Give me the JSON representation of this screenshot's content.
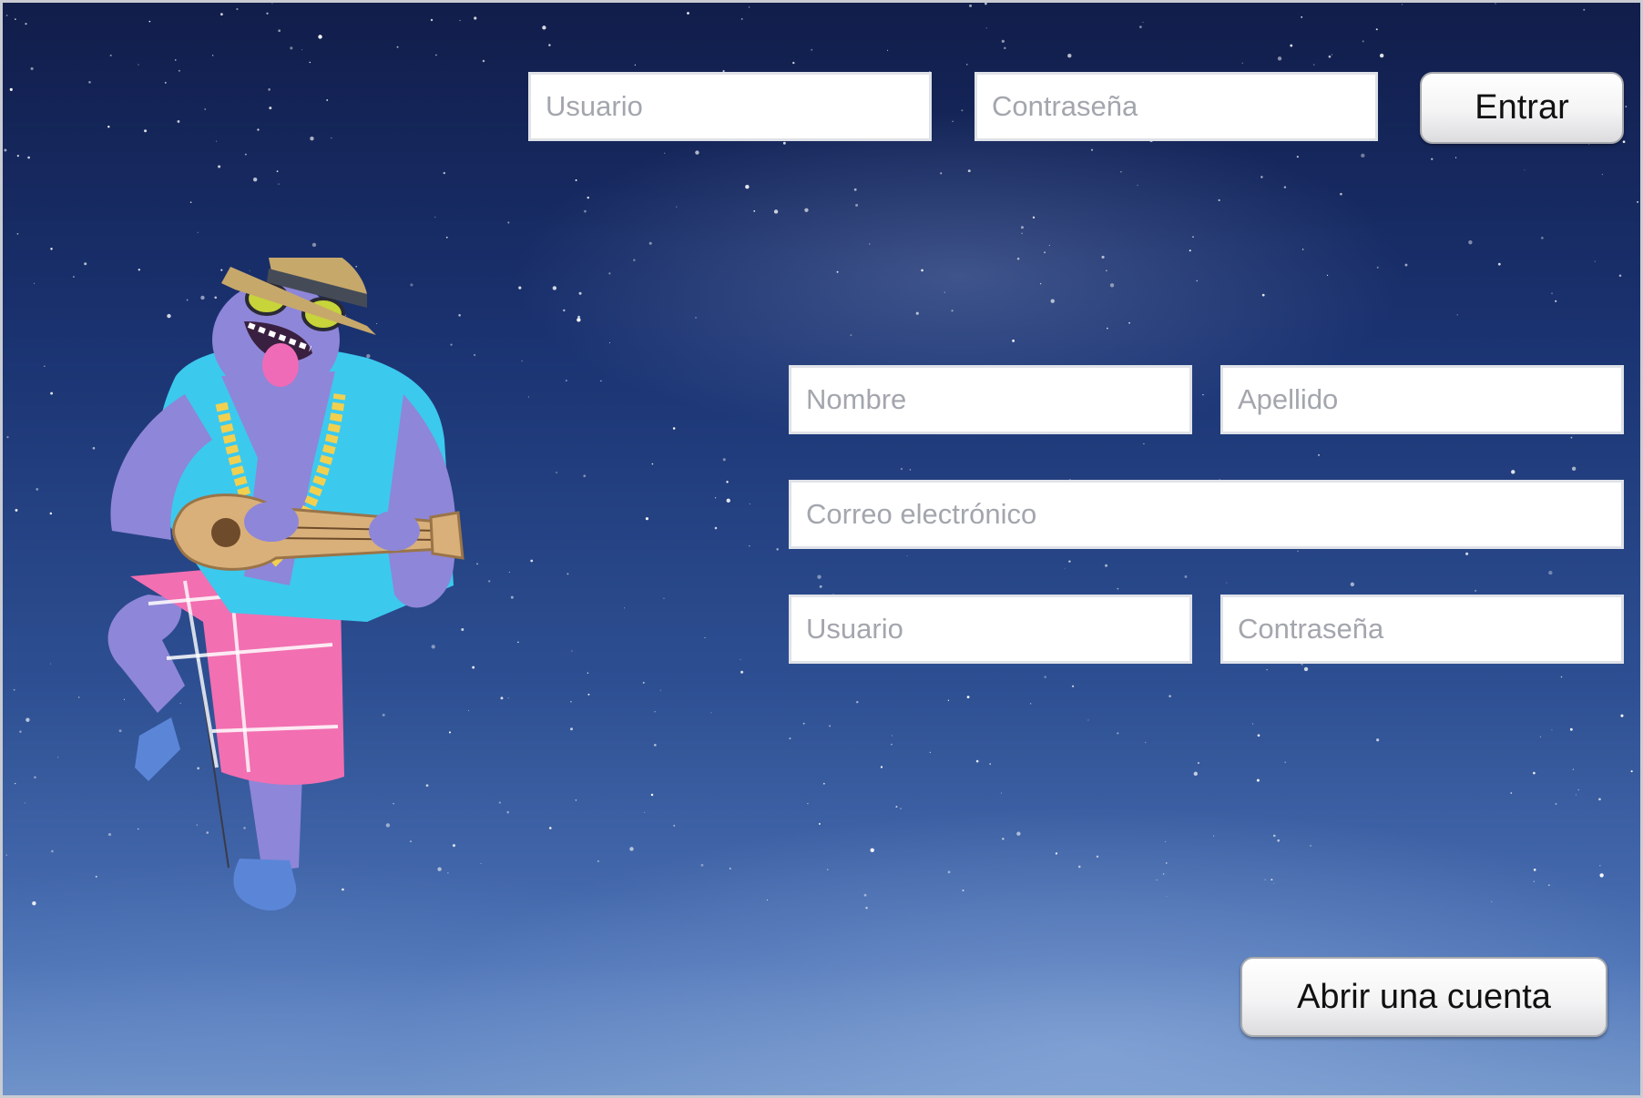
{
  "login": {
    "username_placeholder": "Usuario",
    "password_placeholder": "Contraseña",
    "submit_label": "Entrar"
  },
  "signup": {
    "first_name_placeholder": "Nombre",
    "last_name_placeholder": "Apellido",
    "email_placeholder": "Correo electrónico",
    "username_placeholder": "Usuario",
    "password_placeholder": "Contraseña",
    "submit_label": "Abrir una cuenta"
  },
  "mascot": {
    "icon": "ukulele-musician-mascot-icon"
  },
  "colors": {
    "sky_top": "#111d4a",
    "sky_bottom": "#6f93c8",
    "mascot_skin": "#8e86d8",
    "mascot_shirt": "#3cc9ee",
    "mascot_skirt": "#f26fb1"
  }
}
